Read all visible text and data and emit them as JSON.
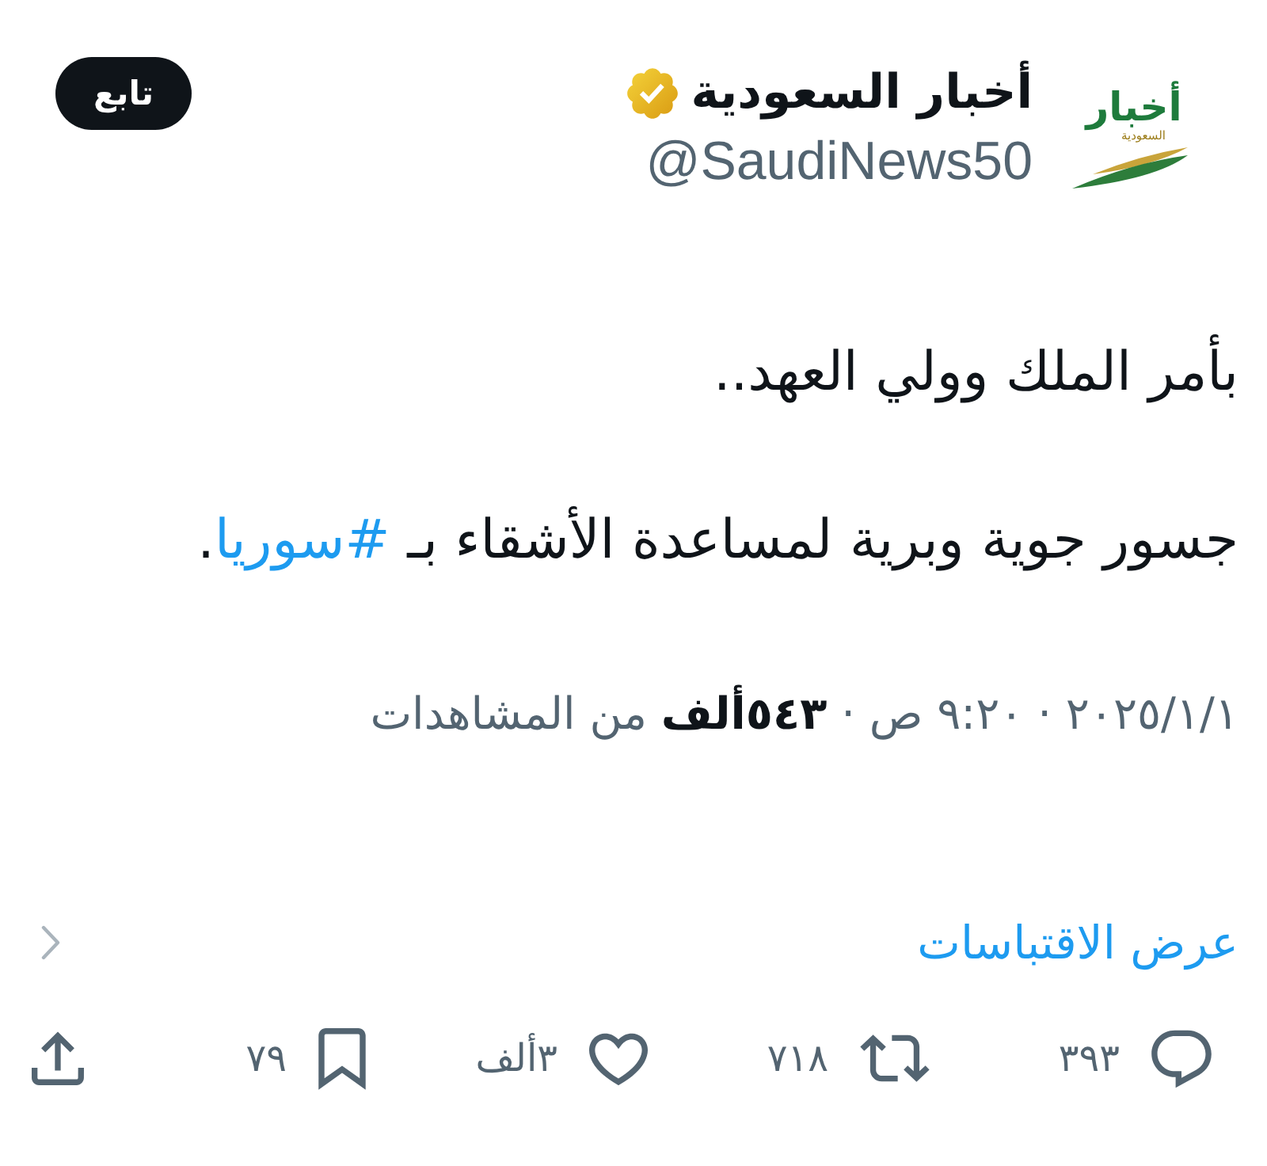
{
  "author": {
    "logo": {
      "title": "أخبار",
      "subtitle": "السعودية"
    },
    "name": "أخبار السعودية",
    "verified": true,
    "handle": "@SaudiNews50"
  },
  "follow_button": {
    "label": "تابع"
  },
  "tweet": {
    "paragraphs": [
      {
        "text": "بأمر الملك وولي العهد.."
      },
      {
        "text": "جسور جوية وبرية لمساعدة الأشقاء بـ ",
        "hashtag": "#سوريا",
        "after": "."
      }
    ]
  },
  "meta": "٢٠٢٥/١/١ · ٩:٢٠ ص · **٥٤٣ألف** من المشاهدات",
  "quotes_link": {
    "label": "عرض الاقتباسات"
  },
  "actions": [
    {
      "kind": "reply",
      "count": "٣٩٣"
    },
    {
      "kind": "repost",
      "count": "٧١٨"
    },
    {
      "kind": "like",
      "count": "٣ألف"
    },
    {
      "kind": "bookmark",
      "count": "٧٩"
    },
    {
      "kind": "share"
    }
  ]
}
